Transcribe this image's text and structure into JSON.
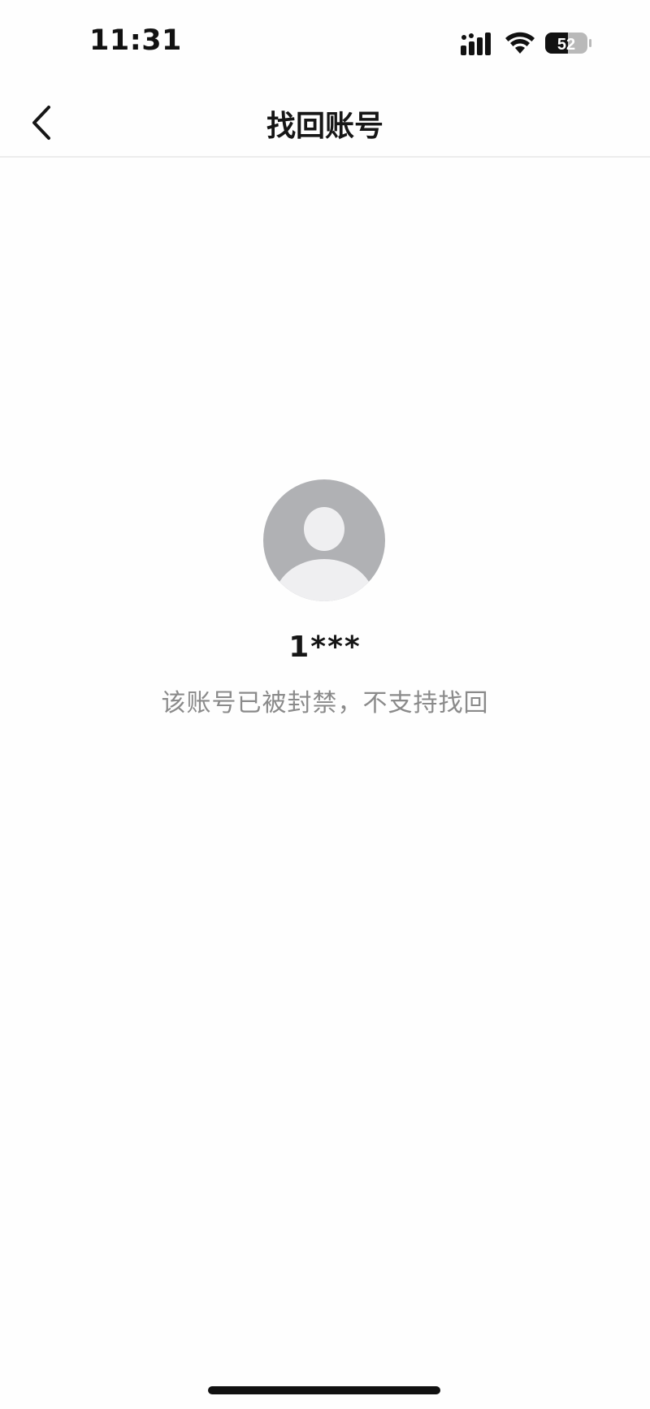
{
  "status_bar": {
    "time": "11:31",
    "battery_level": "52",
    "icons": [
      "cellular-signal-icon",
      "wifi-icon",
      "battery-icon"
    ]
  },
  "nav": {
    "title": "找回账号",
    "back_icon": "chevron-left-icon"
  },
  "account": {
    "avatar_icon": "default-avatar-icon",
    "id_masked": "1***",
    "message": "该账号已被封禁，不支持找回"
  },
  "colors": {
    "background": "#fefefe",
    "title_text": "#161616",
    "secondary_text": "#8a8a8a",
    "avatar_bg": "#b0b1b4",
    "avatar_fg": "#efeff1"
  }
}
